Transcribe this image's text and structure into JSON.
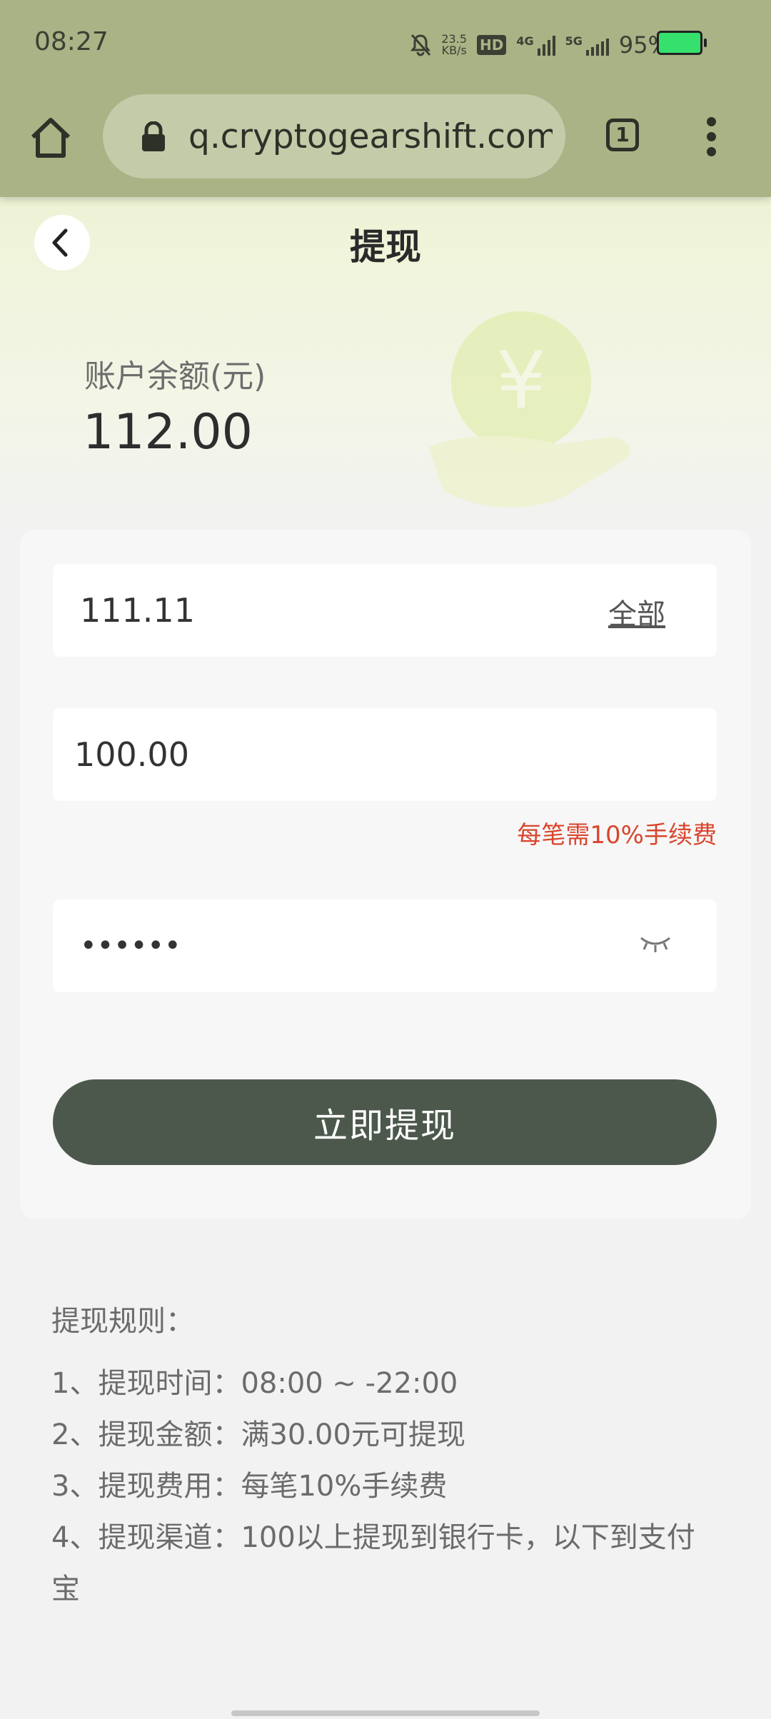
{
  "status_bar": {
    "time": "08:27",
    "net_speed_value": "23.5",
    "net_speed_unit": "KB/s",
    "hd_badge": "HD",
    "signal_4g": "4G",
    "signal_5g": "5G",
    "battery": "95%",
    "battery_color": "#35e06c"
  },
  "browser": {
    "url": "q.cryptogearshift.com",
    "tab_count": "1",
    "icons": [
      "home-icon",
      "lock-icon",
      "tabs-icon",
      "more-vert-icon"
    ]
  },
  "header": {
    "title": "提现"
  },
  "balance": {
    "label": "账户余额(元)",
    "value": "112.00"
  },
  "form": {
    "available_amount": "111.11",
    "all_label": "全部",
    "amount_value": "100.00",
    "fee_hint": "每笔需10%手续费",
    "password_value": "123456",
    "submit_label": "立即提现"
  },
  "rules": {
    "title": "提现规则：",
    "items": [
      "1、提现时间：08:00 ~ -22:00",
      "2、提现金额：满30.00元可提现",
      "3、提现费用：每笔10%手续费",
      "4、提现渠道：100以上提现到银行卡，以下到支付宝"
    ]
  },
  "colors": {
    "chrome": "#a9b386",
    "primary_button": "#4c584b",
    "hint_red": "#d9452d"
  }
}
